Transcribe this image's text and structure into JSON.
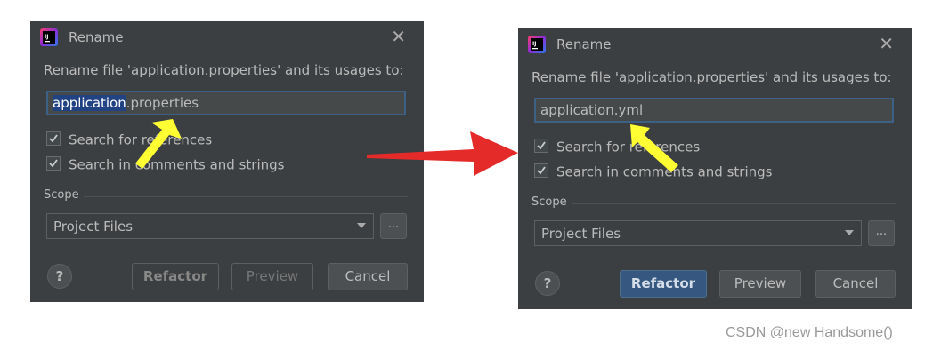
{
  "colors": {
    "dialog_bg": "#3c3f41",
    "text": "#bbbbbb",
    "field_border_focus": "#3d6185",
    "selection_bg": "#214283",
    "default_button": "#365880",
    "annotation_arrow": "#e52a2a",
    "annotation_pointer": "#ffff33"
  },
  "dialogs": [
    {
      "title": "Rename",
      "close_icon": "close-icon",
      "prompt": "Rename file 'application.properties' and its usages to:",
      "input": {
        "selected_part": "application",
        "rest": ".properties"
      },
      "checkboxes": [
        {
          "label": "Search for references",
          "checked": true
        },
        {
          "label": "Search in comments and strings",
          "checked": true
        }
      ],
      "scope_label": "Scope",
      "scope_value": "Project Files",
      "browse_label": "...",
      "help_label": "?",
      "buttons": {
        "refactor": "Refactor",
        "preview": "Preview",
        "cancel": "Cancel"
      },
      "state": "disabled-refactor"
    },
    {
      "title": "Rename",
      "close_icon": "close-icon",
      "prompt": "Rename file 'application.properties' and its usages to:",
      "input": {
        "selected_part": "",
        "rest": "application.yml"
      },
      "checkboxes": [
        {
          "label": "Search for references",
          "checked": true
        },
        {
          "label": "Search in comments and strings",
          "checked": true
        }
      ],
      "scope_label": "Scope",
      "scope_value": "Project Files",
      "browse_label": "...",
      "help_label": "?",
      "buttons": {
        "refactor": "Refactor",
        "preview": "Preview",
        "cancel": "Cancel"
      },
      "state": "enabled-refactor"
    }
  ],
  "watermark": "CSDN @new Handsome()"
}
